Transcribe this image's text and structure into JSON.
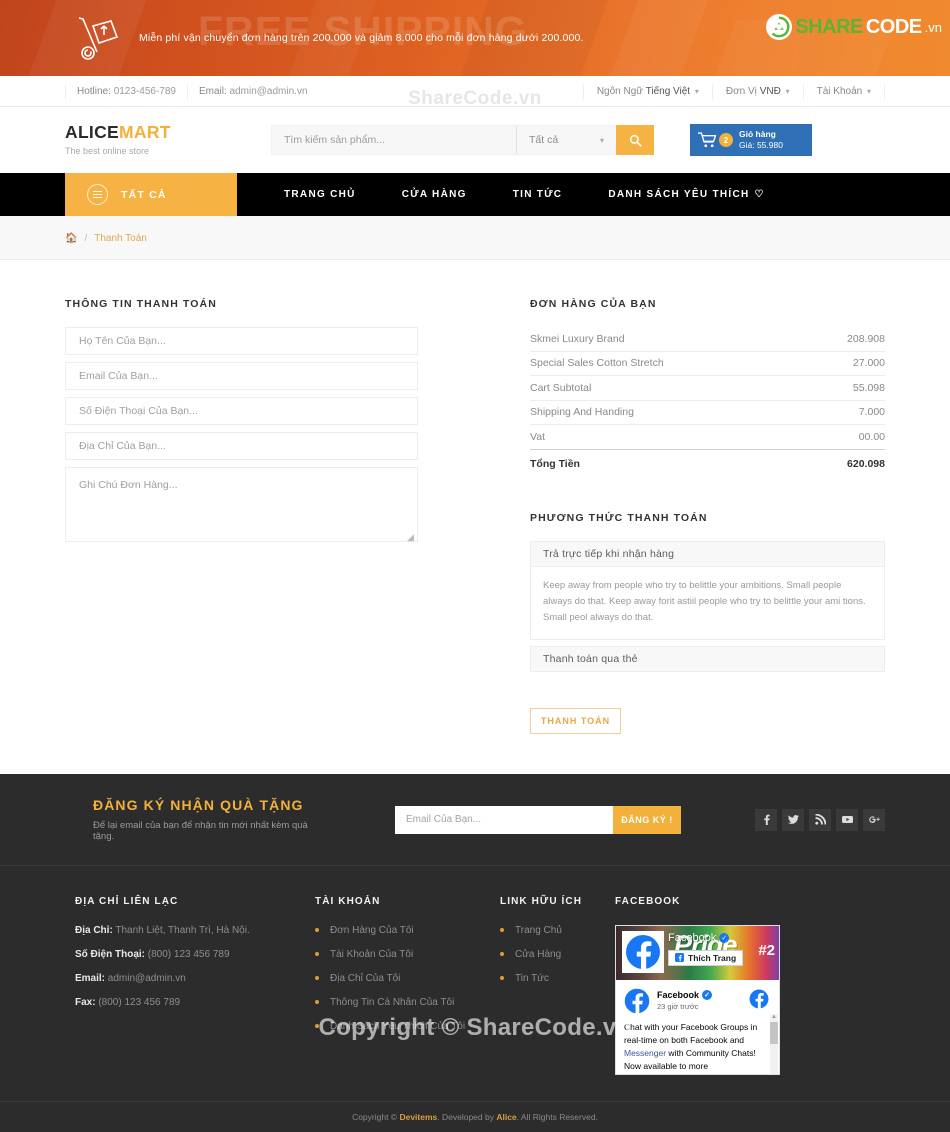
{
  "banner": {
    "watermark": "FREE SHIPPING",
    "message": "Miễn phí vận chuyển đơn hàng trên 200.000 và giảm 8.000 cho mỗi đơn hàng dưới 200.000.",
    "icon": "hand-truck-icon",
    "brand": {
      "part1": "SHARE",
      "part2": "CODE",
      "part3": ".vn"
    },
    "colors": {
      "left": "#c0441d",
      "right": "#f08a2e"
    }
  },
  "topbar": {
    "hotline_label": "Hotline:",
    "hotline_value": "0123-456-789",
    "email_label": "Email:",
    "email_value": "admin@admin.vn",
    "language_label": "Ngôn Ngữ",
    "language_value": "Tiếng Việt",
    "currency_label": "Đơn Vị",
    "currency_value": "VNĐ",
    "account_label": "Tài Khoản",
    "watermark": "ShareCode.vn"
  },
  "header": {
    "logo_part1": "ALICE",
    "logo_part2": "MART",
    "tagline": "The best online store",
    "search_placeholder": "Tìm kiếm sản phẩm...",
    "category_value": "Tất cả",
    "search_icon": "search-icon",
    "cart": {
      "icon": "cart-icon",
      "count": "2",
      "title": "Giỏ hàng",
      "price": "Giá: 55.980"
    }
  },
  "nav": {
    "all_label": "TẤT CẢ",
    "items": [
      {
        "label": "TRANG CHỦ"
      },
      {
        "label": "CỬA HÀNG"
      },
      {
        "label": "TIN TỨC"
      },
      {
        "label": "DANH SÁCH YÊU THÍCH",
        "heart": "♡"
      }
    ]
  },
  "breadcrumb": {
    "home_icon": "home-icon",
    "separator": "/",
    "current": "Thanh Toán"
  },
  "checkout": {
    "form_title": "THÔNG TIN THANH TOÁN",
    "fields": [
      {
        "name": "fullname",
        "placeholder": "Họ Tên Của Bạn...",
        "value": ""
      },
      {
        "name": "email",
        "placeholder": "Email Của Bạn...",
        "value": ""
      },
      {
        "name": "phone",
        "placeholder": "Số Điện Thoại Của Bạn...",
        "value": ""
      },
      {
        "name": "address",
        "placeholder": "Địa Chỉ Của Bạn...",
        "value": ""
      }
    ],
    "note_placeholder": "Ghi Chú Đơn Hàng..."
  },
  "order": {
    "title": "ĐƠN HÀNG CỦA BẠN",
    "rows": [
      {
        "label": "Skmei Luxury Brand",
        "value": "208.908"
      },
      {
        "label": "Special Sales Cotton Stretch",
        "value": "27.000"
      },
      {
        "label": "Cart Subtotal",
        "value": "55.098"
      },
      {
        "label": "Shipping And Handing",
        "value": "7.000"
      },
      {
        "label": "Vat",
        "value": "00.00"
      }
    ],
    "total_label": "Tổng Tiền",
    "total_value": "620.098"
  },
  "payment": {
    "title": "PHƯƠNG THỨC THANH TOÁN",
    "option1_label": "Trả trực tiếp khi nhận hàng",
    "option1_desc": "Keep away from people who try to belittle your ambitions. Small people always do that. Keep away forit astiil people who try to belittle your ami tions. Small peol always do that.",
    "option2_label": "Thanh toán qua thẻ",
    "submit_label": "THANH TOÁN"
  },
  "newsletter": {
    "title": "ĐĂNG KÝ NHẬN QUÀ TẶNG",
    "subtitle": "Để lại email của bạn để nhận tin mới nhất kèm quà tặng.",
    "placeholder": "Email Của Bạn...",
    "button": "ĐĂNG KÝ !",
    "socials": [
      {
        "name": "facebook-icon"
      },
      {
        "name": "twitter-icon"
      },
      {
        "name": "rss-icon"
      },
      {
        "name": "youtube-icon"
      },
      {
        "name": "google-plus-icon"
      }
    ]
  },
  "footer": {
    "contact": {
      "title": "ĐỊA CHỈ LIÊN LẠC",
      "lines": [
        {
          "label": "Địa Chỉ:",
          "value": "Thanh Liệt, Thanh Trì, Hà Nội."
        },
        {
          "label": "Số Điện Thoại:",
          "value": "(800) 123 456 789"
        },
        {
          "label": "Email:",
          "value": "admin@admin.vn"
        },
        {
          "label": "Fax:",
          "value": "(800) 123 456 789"
        }
      ]
    },
    "account": {
      "title": "TÀI KHOẢN",
      "items": [
        {
          "label": "Đơn Hàng Của Tôi"
        },
        {
          "label": "Tài Khoản Của Tôi"
        },
        {
          "label": "Địa Chỉ Của Tôi"
        },
        {
          "label": "Thông Tin Cá Nhân Của Tôi"
        },
        {
          "label": "Danh Sách Yêu Thích Của Tôi"
        }
      ]
    },
    "links": {
      "title": "LINK HỮU ÍCH",
      "items": [
        {
          "label": "Trang Chủ"
        },
        {
          "label": "Cửa Hàng"
        },
        {
          "label": "Tin Tức"
        }
      ]
    },
    "facebook": {
      "title": "FACEBOOK",
      "cover_word": "Pride",
      "cover_hash": "#2",
      "page_name": "Facebook",
      "like_label": "Thích Trang",
      "post_name": "Facebook",
      "post_time": "23 giờ trước",
      "post_text_1": "Chat with your Facebook Groups in real-time on both Facebook and ",
      "post_link": "Messenger",
      "post_text_2": " with Community Chats! Now available to more"
    },
    "watermark": "Copyright © ShareCode.vn",
    "copyright_pre": "Copyright ©",
    "copyright_brand1": "Devitems",
    "copyright_mid": ". Developed by",
    "copyright_brand2": "Alice",
    "copyright_post": ". All Rights Reserved."
  }
}
